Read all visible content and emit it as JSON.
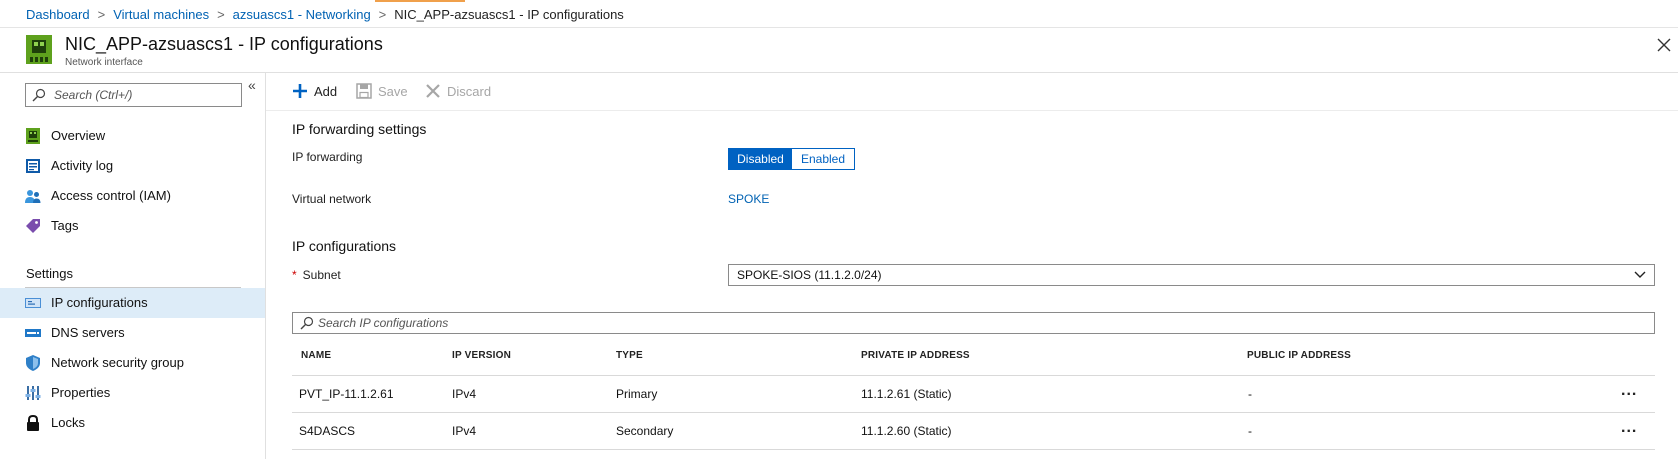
{
  "breadcrumb": {
    "items": [
      "Dashboard",
      "Virtual machines",
      "azsuascs1 - Networking"
    ],
    "current": "NIC_APP-azsuascs1 - IP configurations",
    "separator": ">"
  },
  "header": {
    "title": "NIC_APP-azsuascs1 - IP configurations",
    "subtitle": "Network interface"
  },
  "sidebar": {
    "search_placeholder": "Search (Ctrl+/)",
    "collapse_glyph": "«",
    "items": [
      {
        "label": "Overview",
        "icon": "overview-icon"
      },
      {
        "label": "Activity log",
        "icon": "activity-log-icon"
      },
      {
        "label": "Access control (IAM)",
        "icon": "iam-icon"
      },
      {
        "label": "Tags",
        "icon": "tag-icon"
      }
    ],
    "settings_heading": "Settings",
    "settings_items": [
      {
        "label": "IP configurations",
        "icon": "ip-configurations-icon",
        "selected": true
      },
      {
        "label": "DNS servers",
        "icon": "dns-icon"
      },
      {
        "label": "Network security group",
        "icon": "shield-icon"
      },
      {
        "label": "Properties",
        "icon": "properties-icon"
      },
      {
        "label": "Locks",
        "icon": "lock-icon"
      }
    ]
  },
  "toolbar": {
    "add_label": "Add",
    "save_label": "Save",
    "discard_label": "Discard"
  },
  "ip_forwarding": {
    "heading": "IP forwarding settings",
    "label": "IP forwarding",
    "options": [
      "Disabled",
      "Enabled"
    ],
    "selected": "Disabled",
    "vnet_label": "Virtual network",
    "vnet_value": "SPOKE"
  },
  "ip_configurations": {
    "heading": "IP configurations",
    "required_marker": "*",
    "subnet_label": "Subnet",
    "subnet_value": "SPOKE-SIOS (11.1.2.0/24)",
    "search_placeholder": "Search IP configurations",
    "columns": [
      "NAME",
      "IP VERSION",
      "TYPE",
      "PRIVATE IP ADDRESS",
      "PUBLIC IP ADDRESS"
    ],
    "rows": [
      {
        "name": "PVT_IP-11.1.2.61",
        "version": "IPv4",
        "type": "Primary",
        "private_ip": "11.1.2.61 (Static)",
        "public_ip": "-",
        "more": "..."
      },
      {
        "name": "S4DASCS",
        "version": "IPv4",
        "type": "Secondary",
        "private_ip": "11.1.2.60 (Static)",
        "public_ip": "-",
        "more": "..."
      }
    ]
  },
  "colors": {
    "accent": "#0062c2",
    "link": "#0062b3",
    "selected_bg": "#ddecf8",
    "required": "#cc0000"
  }
}
